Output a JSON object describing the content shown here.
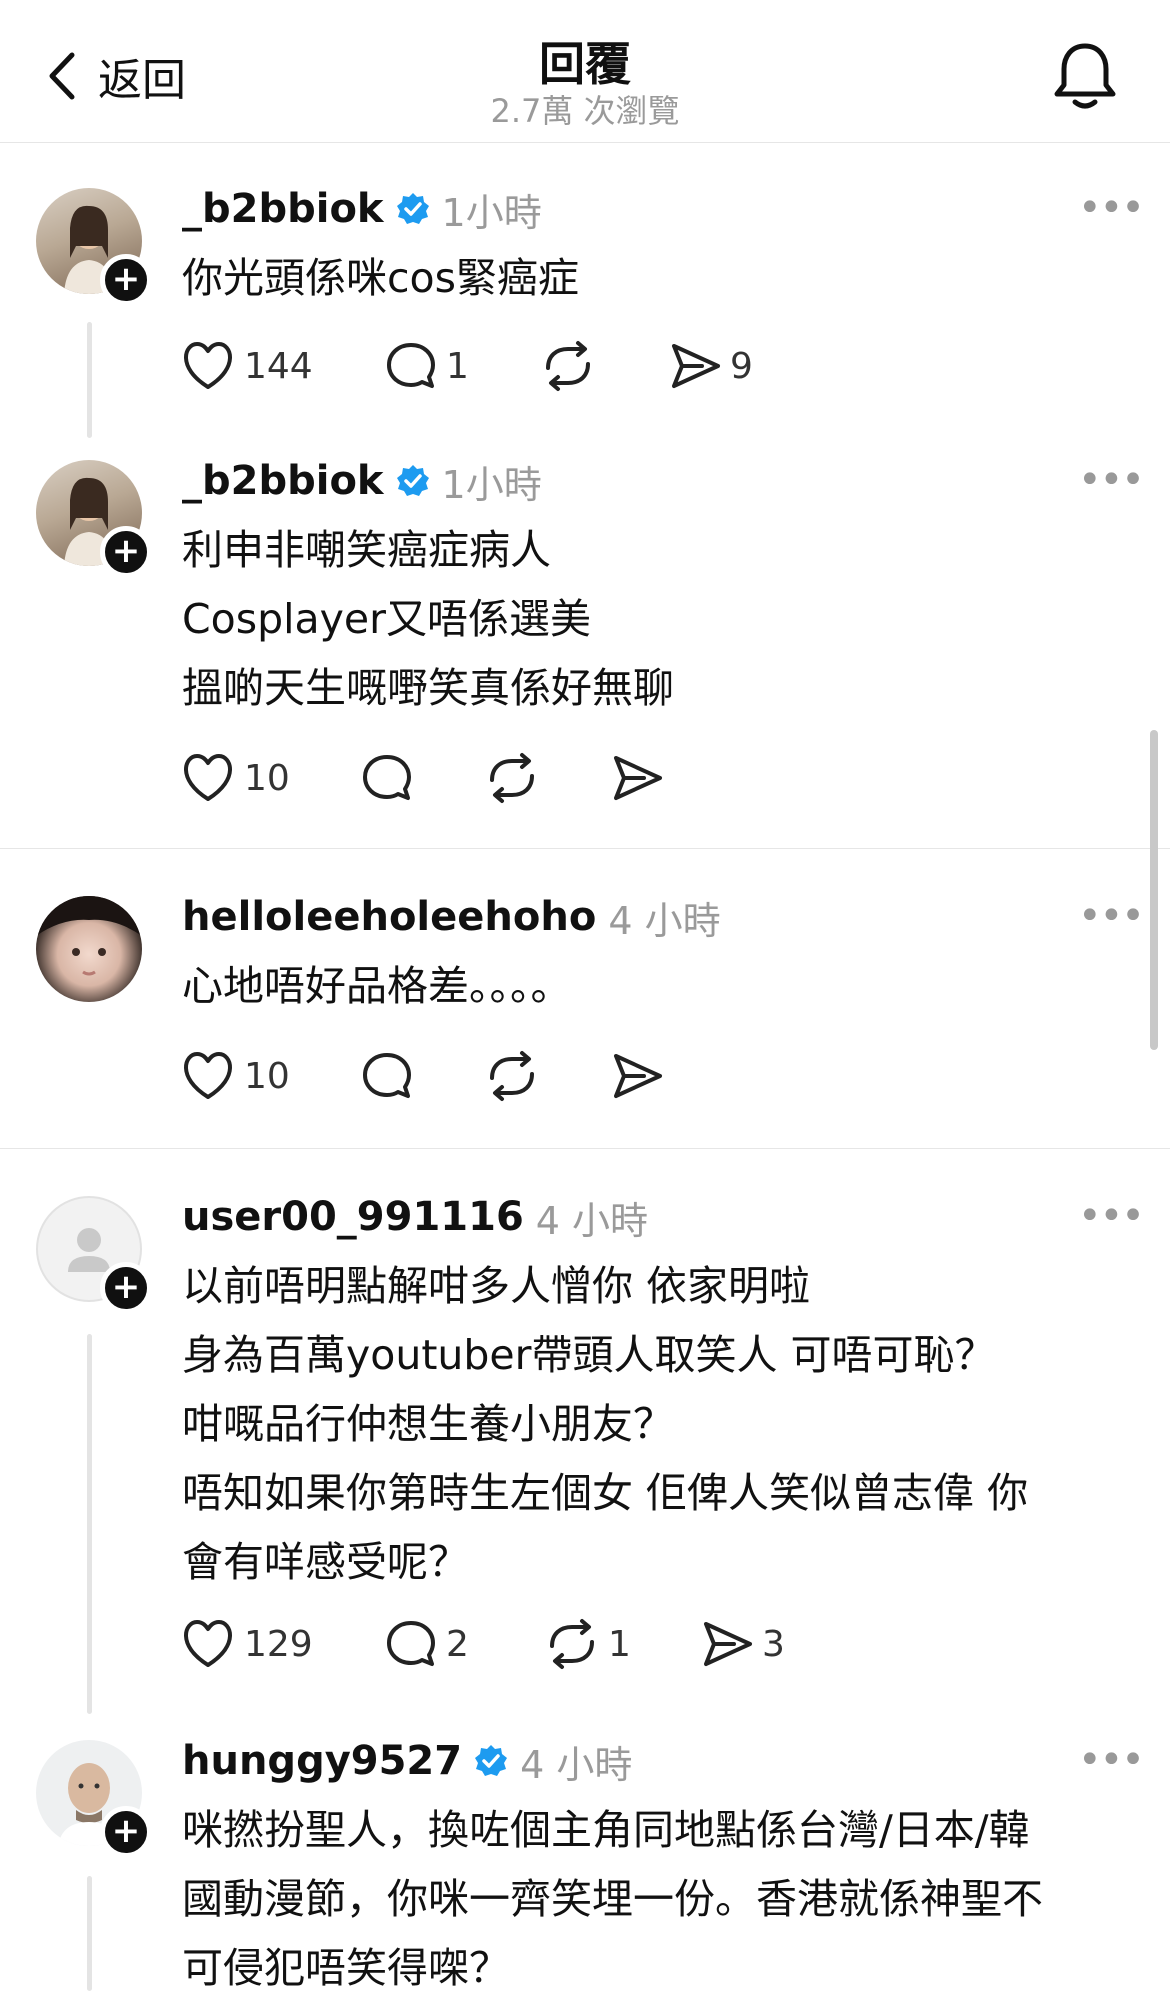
{
  "header": {
    "back_label": "返回",
    "title": "回覆",
    "views": "2.7萬 次瀏覽"
  },
  "posts": [
    {
      "username": "_b2bbiok",
      "verified": true,
      "time": "1小時",
      "lines": [
        "你光頭係咪cos緊癌症"
      ],
      "likes": "144",
      "replies": "1",
      "reposts": "",
      "shares": "9"
    },
    {
      "username": "_b2bbiok",
      "verified": true,
      "time": "1小時",
      "lines": [
        "利申非嘲笑癌症病人",
        "Cosplayer又唔係選美",
        "搵啲天生嘅嘢笑真係好無聊"
      ],
      "likes": "10",
      "replies": "",
      "reposts": "",
      "shares": ""
    },
    {
      "username": "helloleeholeehoho",
      "verified": false,
      "time": "4 小時",
      "lines": [
        "心地唔好品格差。。。。"
      ],
      "likes": "10",
      "replies": "",
      "reposts": "",
      "shares": ""
    },
    {
      "username": "user00_991116",
      "verified": false,
      "time": "4 小時",
      "lines": [
        "以前唔明點解咁多人憎你 依家明啦",
        "身為百萬youtuber帶頭人取笑人 可唔可恥？",
        "咁嘅品行仲想生養小朋友？",
        "唔知如果你第時生左個女 佢俾人笑似曾志偉 你",
        "會有咩感受呢？"
      ],
      "likes": "129",
      "replies": "2",
      "reposts": "1",
      "shares": "3"
    },
    {
      "username": "hunggy9527",
      "verified": true,
      "time": "4 小時",
      "lines": [
        "咪撚扮聖人，換咗個主角同地點係台灣/日本/韓",
        "國動漫節，你咪一齊笑埋一份。香港就係神聖不",
        "可侵犯唔笑得㗎？"
      ],
      "likes": "",
      "replies": "",
      "reposts": "",
      "shares": ""
    }
  ],
  "colors": {
    "verified": "#1d9bf0",
    "muted": "#9a9a9a",
    "text": "#111111"
  }
}
